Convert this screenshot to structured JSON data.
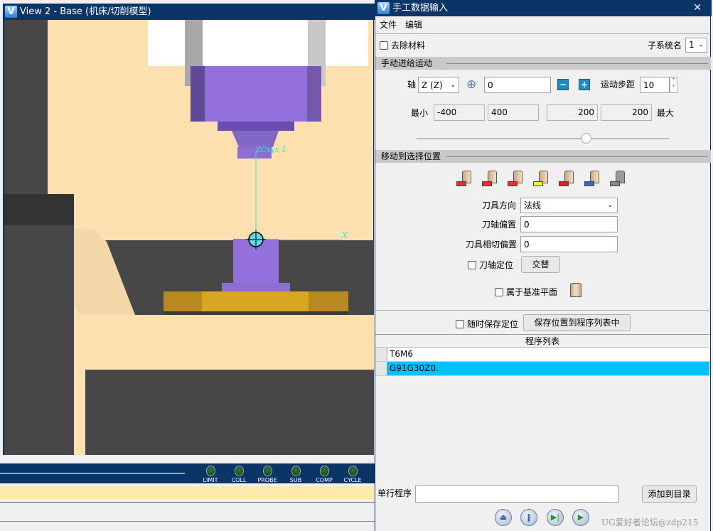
{
  "view_window": {
    "title": "View 2 - Base (机床/切削模型)",
    "csys_label": "ZCsys 1",
    "x_axis_label": "X"
  },
  "status_leds": [
    "LIMIT",
    "COLL",
    "PROBE",
    "SUB",
    "COMP",
    "CYCLE"
  ],
  "dialog": {
    "title": "手工数据输入",
    "close": "✕",
    "menu": [
      "文件",
      "编辑"
    ],
    "remove_material": {
      "label": "去除材料",
      "checked": false
    },
    "subsystem": {
      "label": "子系统名",
      "value": "1"
    },
    "jog_section": {
      "title": "手动进给运动",
      "axis_label": "轴",
      "axis_value": "Z (Z)",
      "position": "0",
      "step_label": "运动步距",
      "step_value": "10",
      "min_label": "最小",
      "max_label": "最大",
      "min_value": "-400",
      "range1": "400",
      "range2": "200",
      "max_value": "200",
      "slider_fraction": 0.67
    },
    "move_section": {
      "title": "移动到选择位置",
      "tool_icons": [
        "align-to-plane-icon",
        "align-to-edge-icon",
        "align-to-point-icon",
        "align-to-face-icon",
        "csys-move-icon",
        "align-to-surface-icon",
        "align-to-wall-icon"
      ],
      "tool_direction_label": "刀具方向",
      "tool_direction_value": "法线",
      "axis_offset_label": "刀轴偏置",
      "axis_offset_value": "0",
      "tangent_offset_label": "刀具相切偏置",
      "tangent_offset_value": "0",
      "axis_locate_label": "刀轴定位",
      "alternate_button": "交替",
      "on_base_plane_label": "属于基准平面"
    },
    "save_always_label": "随时保存定位",
    "save_to_list_button": "保存位置到程序列表中",
    "program_list": {
      "header": "程序列表",
      "rows": [
        "T6M6",
        "G91G30Z0."
      ],
      "selected": 1
    },
    "single_line_label": "单行程序",
    "single_line_value": "",
    "add_button": "添加到目录",
    "watermark": "UG爱好者论坛@zdp215"
  },
  "colors": {
    "title_bar": "#0b3566",
    "selected_row": "#00bfff",
    "tool": "#9370db",
    "fixture": "#daa520",
    "background": "#fde0b0"
  }
}
